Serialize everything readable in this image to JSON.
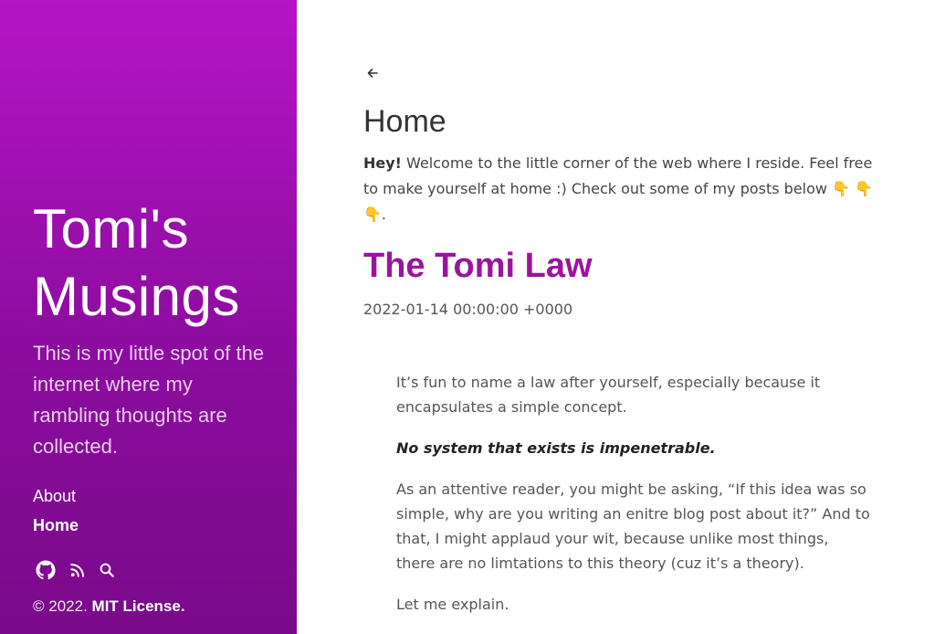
{
  "sidebar": {
    "title": "Tomi's Musings",
    "tagline": "This is my little spot of the internet where my rambling thoughts are collected.",
    "nav": [
      {
        "label": "About",
        "active": false
      },
      {
        "label": "Home",
        "active": true
      }
    ],
    "social_icons": [
      "github-icon",
      "rss-icon",
      "search-icon"
    ],
    "copyright_prefix": "© 2022.",
    "license": "MIT License."
  },
  "main": {
    "page_title": "Home",
    "intro_bold": "Hey!",
    "intro_text": " Welcome to the little corner of the web where I reside. Feel free to make yourself at home :) Check out some of my posts below ",
    "intro_emojis": "👇 👇 👇",
    "intro_end": ".",
    "post": {
      "title": "The Tomi Law",
      "date": "2022-01-14 00:00:00 +0000",
      "paragraphs": [
        "It’s fun to name a law after yourself, especially because it encapsulates a simple concept.",
        "No system that exists is impenetrable.",
        "As an attentive reader, you might be asking, “If this idea was so simple, why are you writing an enitre blog post about it?” And to that, I might applaud your wit, because unlike most things, there are no limtations to this theory (cuz it’s a theory).",
        "Let me explain."
      ]
    }
  },
  "colors": {
    "sidebar_top": "#b515c5",
    "sidebar_bottom": "#7a0a8a",
    "post_title": "#9b149e"
  }
}
